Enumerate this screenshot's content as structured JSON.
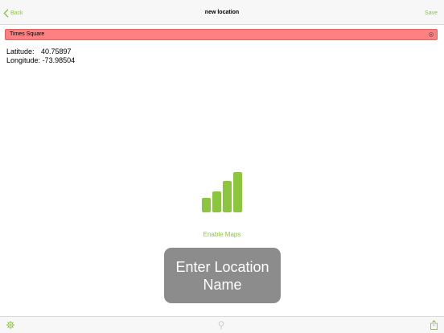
{
  "navbar": {
    "back_label": "Back",
    "title": "new location",
    "save_label": "Save"
  },
  "search": {
    "value": "Times Square"
  },
  "coordinates": {
    "latitude_label": "Latitude:",
    "latitude_value": "40.75897",
    "longitude_label": "Longitude:",
    "longitude_value": "-73.98504"
  },
  "maps": {
    "icon": "signal-bars-icon",
    "enable_label": "Enable Maps"
  },
  "toast": {
    "message": "Enter Location Name"
  },
  "toolbar": {
    "icons": [
      "settings-icon",
      "location-pin-icon",
      "share-icon"
    ]
  },
  "colors": {
    "accent": "#8cc63f",
    "search_background": "#ff8080",
    "toast_background": "#8c8c8c"
  }
}
